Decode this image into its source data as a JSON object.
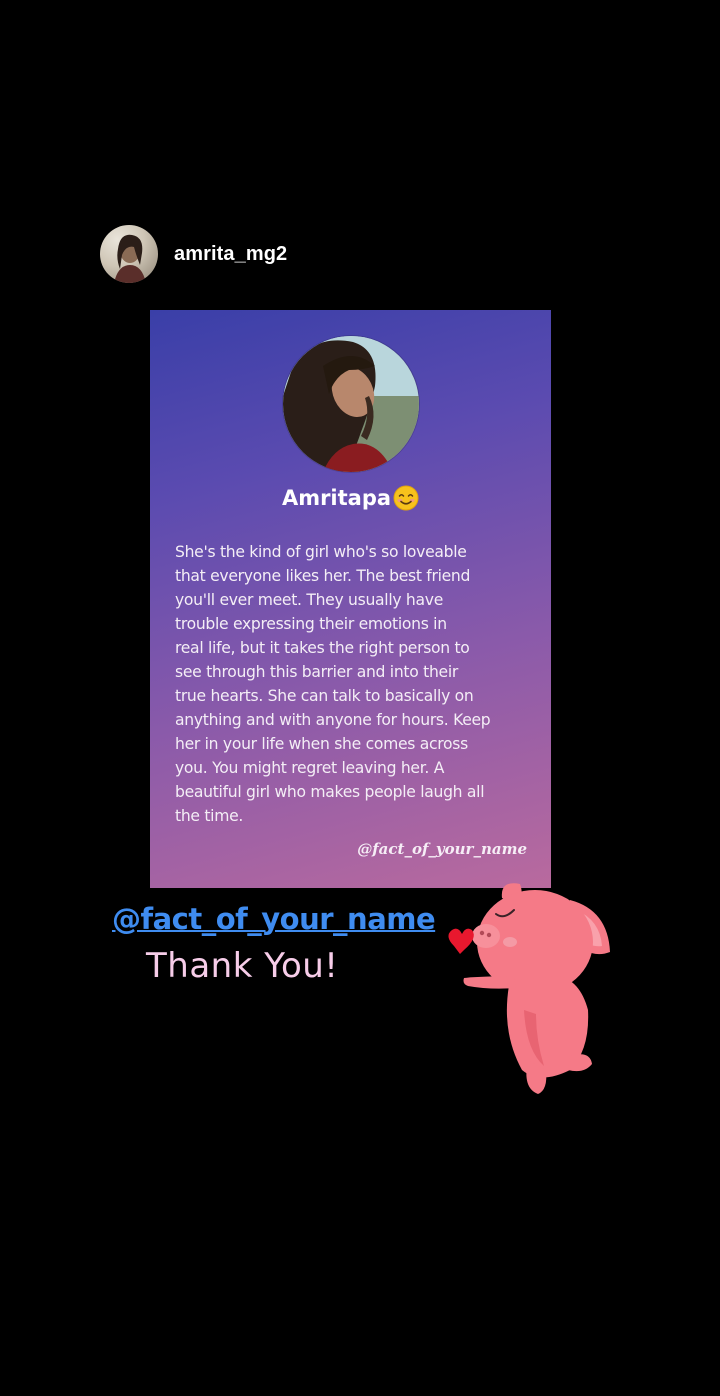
{
  "story": {
    "username": "amrita_mg2"
  },
  "card": {
    "name": "Amritapa",
    "emoji_icon": "smiling-face-icon",
    "body": "She's the kind of girl who's so loveable\nthat everyone likes her. The best friend\nyou'll ever meet. They usually have\ntrouble expressing their emotions in\nreal life, but it takes the right person to\nsee through this barrier and into their\ntrue hearts. She can talk to basically on\nanything and with anyone for hours. Keep\nher in your life when she comes across\nyou. You might regret leaving her. A\nbeautiful girl who makes people laugh all\nthe time.",
    "handle": "@fact_of_your_name"
  },
  "overlay": {
    "mention": "@fact_of_your_name",
    "thanks": "Thank You!",
    "sticker_icon": "pig-blowing-kiss-icon"
  },
  "colors": {
    "background": "#000000",
    "card_gradient_start": "#3a3fa8",
    "card_gradient_end": "#b96a9e",
    "mention": "#3f8cf0",
    "thanks": "#f7cde9",
    "pig": "#f57a87"
  }
}
